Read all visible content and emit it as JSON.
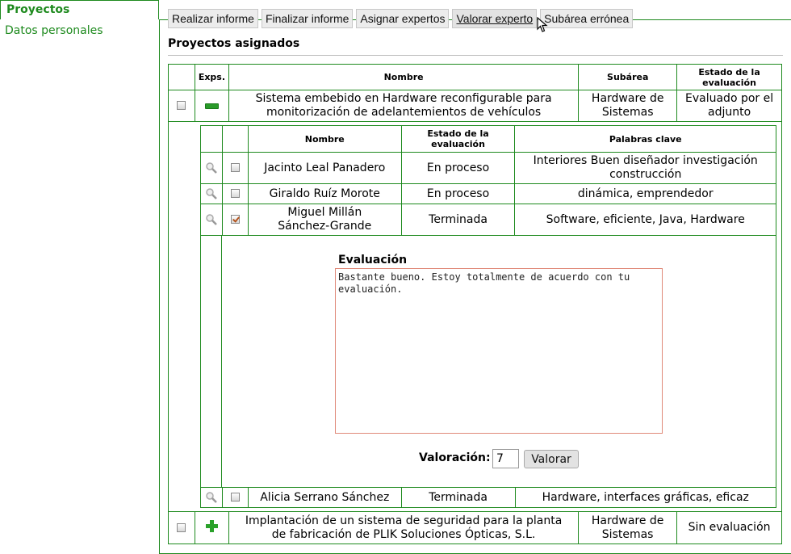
{
  "sidebar": {
    "active_tab": "Proyectos",
    "items": [
      {
        "label": "Datos personales"
      }
    ]
  },
  "toolbar": {
    "buttons": [
      {
        "label": "Realizar informe"
      },
      {
        "label": "Finalizar informe"
      },
      {
        "label": "Asignar expertos"
      },
      {
        "label": "Valorar experto"
      },
      {
        "label": "Subárea errónea"
      }
    ]
  },
  "section": {
    "title": "Proyectos asignados"
  },
  "projects_table": {
    "headers": {
      "exps": "Exps.",
      "name": "Nombre",
      "subarea": "Subárea",
      "status": "Estado de la evaluación"
    },
    "rows": [
      {
        "name": "Sistema embebido en Hardware reconfigurable para monitorización de adelantemientos de vehículos",
        "subarea": "Hardware de Sistemas",
        "status": "Evaluado por el adjunto",
        "expanded": true
      },
      {
        "name": "Implantación de un sistema de seguridad para la planta de fabricación de PLIK Soluciones Ópticas, S.L.",
        "subarea": "Hardware de Sistemas",
        "status": "Sin evaluación",
        "expanded": false
      }
    ]
  },
  "experts_table": {
    "headers": {
      "name": "Nombre",
      "status": "Estado de la evaluación",
      "keywords": "Palabras clave"
    },
    "rows": [
      {
        "name": "Jacinto Leal Panadero",
        "status": "En proceso",
        "keywords": "Interiores Buen diseñador investigación construcción",
        "checked": false
      },
      {
        "name": "Giraldo Ruíz Morote",
        "status": "En proceso",
        "keywords": "dinámica, emprendedor",
        "checked": false
      },
      {
        "name": "Miguel Millán Sánchez-Grande",
        "status": "Terminada",
        "keywords": "Software, eficiente, Java, Hardware",
        "checked": true
      },
      {
        "name": "Alicia Serrano Sánchez",
        "status": "Terminada",
        "keywords": "Hardware, interfaces gráficas, eficaz",
        "checked": false
      }
    ]
  },
  "evaluation": {
    "label": "Evaluación",
    "text": "Bastante bueno. Estoy totalmente de acuerdo con tu evaluación.",
    "rating_label": "Valoración:",
    "rating_value": "7",
    "submit_label": "Valorar"
  },
  "colors": {
    "accent": "#1e8a1e",
    "textarea_border": "#e08a7a"
  }
}
